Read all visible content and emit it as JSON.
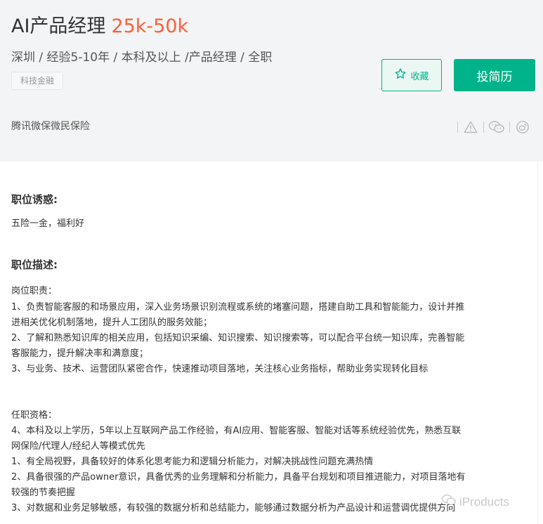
{
  "job": {
    "title": "AI产品经理",
    "salary": "25k-50k",
    "requirements": "深圳 / 经验5-10年 / 本科及以上 /产品经理 / 全职",
    "tag": "科技金融",
    "company": "腾讯微保微民保险"
  },
  "actions": {
    "favorite_label": "收藏",
    "apply_label": "投简历"
  },
  "tools": {
    "icons": [
      "warning-icon",
      "wechat-icon",
      "weibo-icon"
    ]
  },
  "sections": {
    "benefits_title": "职位诱惑:",
    "benefits_text": "五险一金，福利好",
    "description_title": "职位描述:",
    "lines": [
      "岗位职责：",
      "1、负责智能客服的和场景应用，深入业务场景识别流程或系统的堵塞问题，搭建自助工具和智能能力，设计并推",
      "进相关优化机制落地，提升人工团队的服务效能；",
      "2、了解和熟悉知识库的相关应用，包括知识采编、知识搜索、知识搜索等，可以配合平台统一知识库，完善智能",
      "客服能力，提升解决率和满意度；",
      "3、与业务、技术、运营团队紧密合作，快速推动项目落地，关注核心业务指标，帮助业务实现转化目标",
      "任职资格：",
      "4、本科及以上学历，5年以上互联网产品工作经验，有AI应用、智能客服、智能对话等系统经验优先，熟悉互联",
      "网保险/代理人/经纪人等模式优先",
      "1、有全局视野，具备较好的体系化思考能力和逻辑分析能力，对解决挑战性问题充满热情",
      "2、具备很强的产品owner意识，具备优秀的业务理解和分析能力，具备平台规划和项目推进能力，对项目落地有",
      "较强的节奏把握",
      "3、对数据和业务足够敏感，有较强的数据分析和总结能力，能够通过数据分析为产品设计和运营调优提供方向"
    ]
  },
  "watermark": {
    "text": "iProducts"
  },
  "colors": {
    "brand": "#00b38a",
    "salary": "#fd5f39",
    "header_bg": "#f3f4f5"
  }
}
